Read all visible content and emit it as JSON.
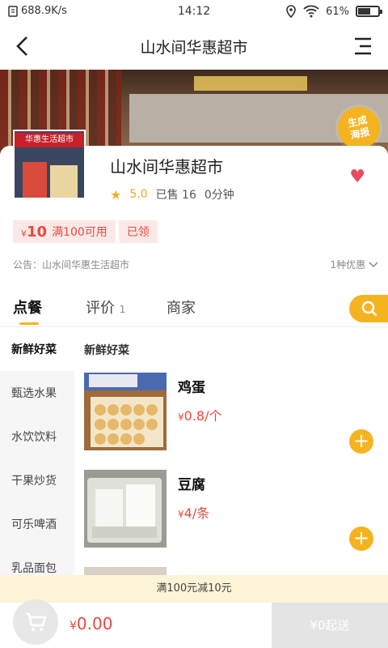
{
  "status_bar": {
    "net_speed": "688.9K/s",
    "time": "14:12",
    "battery": "61%",
    "battery_level": 0.61
  },
  "nav": {
    "title": "山水间华惠超市"
  },
  "banner": {
    "badge_line1": "生成",
    "badge_line2": "海报"
  },
  "store": {
    "thumb_sign": "华惠生活超市",
    "name": "山水间华惠超市",
    "rating": "5.0",
    "sold": "已售 16",
    "delivery": "0分钟",
    "coupon": {
      "currency": "¥",
      "amount": "10",
      "condition": "满100可用",
      "status": "已领"
    },
    "notice": "公告：山水间华惠生活超市",
    "promo_count": "1种优惠"
  },
  "tabs": [
    {
      "label": "点餐",
      "count": ""
    },
    {
      "label": "评价",
      "count": "1"
    },
    {
      "label": "商家",
      "count": ""
    }
  ],
  "categories": [
    "新鲜好菜",
    "甄选水果",
    "水饮饮料",
    "干果炒货",
    "可乐啤酒",
    "乳品面包"
  ],
  "section_title": "新鲜好菜",
  "products": [
    {
      "name": "鸡蛋",
      "currency": "¥",
      "price": "0.8/个"
    },
    {
      "name": "豆腐",
      "currency": "¥",
      "price": "4/条"
    }
  ],
  "promo_strip": "满100元减10元",
  "bottom": {
    "currency": "¥",
    "total": "0.00",
    "checkout": "¥0起送"
  },
  "colors": {
    "accent": "#f5b320",
    "price": "#e84a3f",
    "heart": "#e84a5f"
  }
}
